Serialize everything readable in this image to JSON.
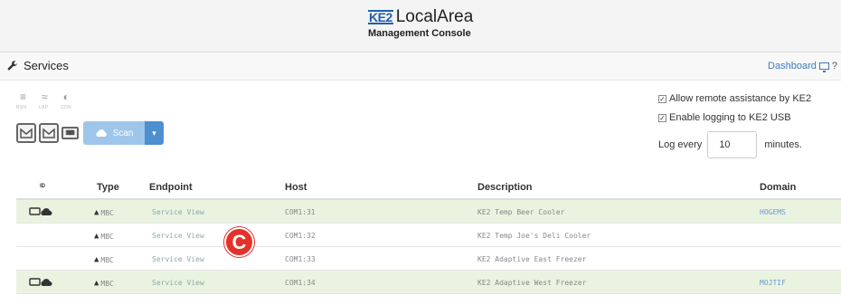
{
  "header": {
    "logo_mark": "KE2",
    "logo_name": "LocalArea",
    "logo_sub": "Management Console"
  },
  "subbar": {
    "title": "Services",
    "dashboard_label": "Dashboard",
    "help_label": "?"
  },
  "toolbar": {
    "small_icons": [
      "menu-icon",
      "wifi-icon",
      "globe-icon"
    ],
    "small_labels": [
      "RSN",
      "LAP",
      "CON"
    ],
    "scan_label": "Scan"
  },
  "options": {
    "remote_label": "Allow remote assistance by KE2",
    "remote_checked": true,
    "logging_label": "Enable logging to KE2 USB",
    "logging_checked": true,
    "log_every_label": "Log every",
    "log_every_value": "10",
    "log_unit": "minutes."
  },
  "table": {
    "columns": [
      "ID",
      "Type",
      "Endpoint",
      "Host",
      "Description",
      "Domain"
    ],
    "rows": [
      {
        "type": "MBC",
        "endpoint": "Service View",
        "host": "COM1:31",
        "description": "KE2 Temp Beer Cooler",
        "domain": "HOGEMS",
        "online": true
      },
      {
        "type": "MBC",
        "endpoint": "Service View",
        "host": "COM1:32",
        "description": "KE2 Temp Joe's Deli Cooler",
        "domain": "",
        "online": false
      },
      {
        "type": "MBC",
        "endpoint": "Service View",
        "host": "COM1:33",
        "description": "KE2 Adaptive East Freezer",
        "domain": "",
        "online": false
      },
      {
        "type": "MBC",
        "endpoint": "Service View",
        "host": "COM1:34",
        "description": "KE2 Adaptive West Freezer",
        "domain": "MOJTIF",
        "online": true
      }
    ]
  },
  "callout": {
    "letter": "C",
    "color": "#e4322b"
  }
}
